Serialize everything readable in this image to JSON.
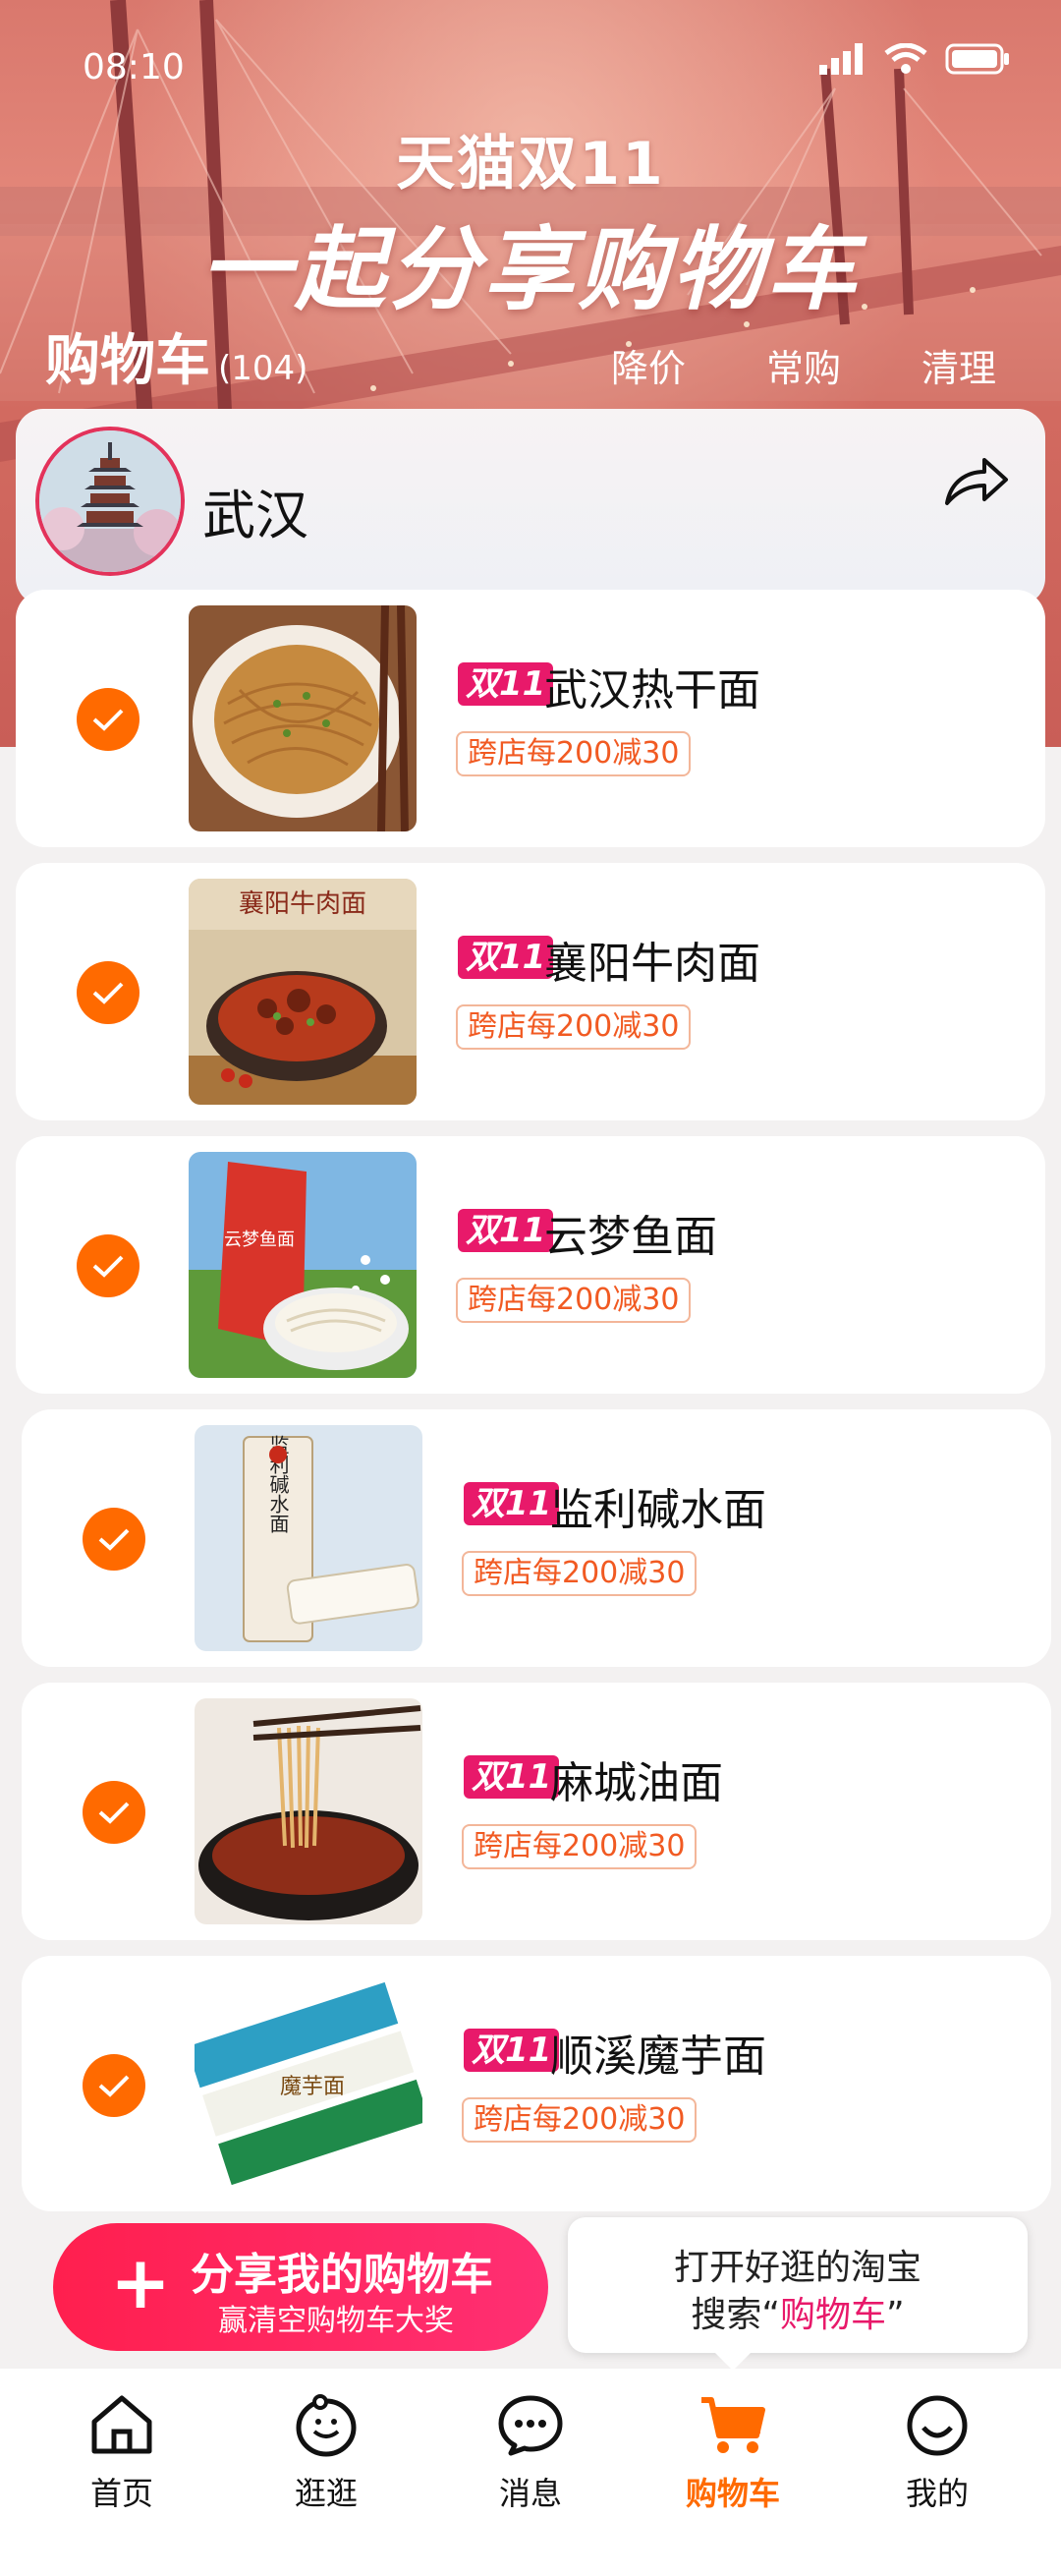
{
  "status": {
    "time": "08:10"
  },
  "hero": {
    "line1": "天猫双11",
    "line2": "一起分享购物车"
  },
  "header": {
    "title": "购物车",
    "count": "(104)",
    "actions": [
      "降价",
      "常购",
      "清理"
    ]
  },
  "store": {
    "name": "武汉"
  },
  "items": [
    {
      "badge": "双11",
      "name": "武汉热干面",
      "promo": "跨店每200减30",
      "checked": true
    },
    {
      "badge": "双11",
      "name": "襄阳牛肉面",
      "promo": "跨店每200减30",
      "checked": true
    },
    {
      "badge": "双11",
      "name": "云梦鱼面",
      "promo": "跨店每200减30",
      "checked": true
    },
    {
      "badge": "双11",
      "name": "监利碱水面",
      "promo": "跨店每200减30",
      "checked": true
    },
    {
      "badge": "双11",
      "name": "麻城油面",
      "promo": "跨店每200减30",
      "checked": true
    },
    {
      "badge": "双11",
      "name": "顺溪魔芋面",
      "promo": "跨店每200减30",
      "checked": true
    }
  ],
  "thumb_text": {
    "item2_banner": "襄阳牛肉面",
    "item3_pack": "云梦鱼面",
    "item4_pack": "监利碱水面",
    "item6_pack": "魔芋面"
  },
  "share": {
    "plus": "+",
    "main": "分享我的购物车",
    "sub": "赢清空购物车大奖"
  },
  "tip": {
    "line1": "打开好逛的淘宝",
    "line2_prefix": "搜索“",
    "line2_highlight": "购物车",
    "line2_suffix": "”"
  },
  "tabs": [
    {
      "label": "首页",
      "icon": "home-icon"
    },
    {
      "label": "逛逛",
      "icon": "browse-icon"
    },
    {
      "label": "消息",
      "icon": "message-icon"
    },
    {
      "label": "购物车",
      "icon": "cart-icon",
      "active": true
    },
    {
      "label": "我的",
      "icon": "profile-icon"
    }
  ],
  "colors": {
    "accent": "#ff6a00",
    "brand_pink": "#e8196a",
    "share_red": "#ff1f4e"
  }
}
